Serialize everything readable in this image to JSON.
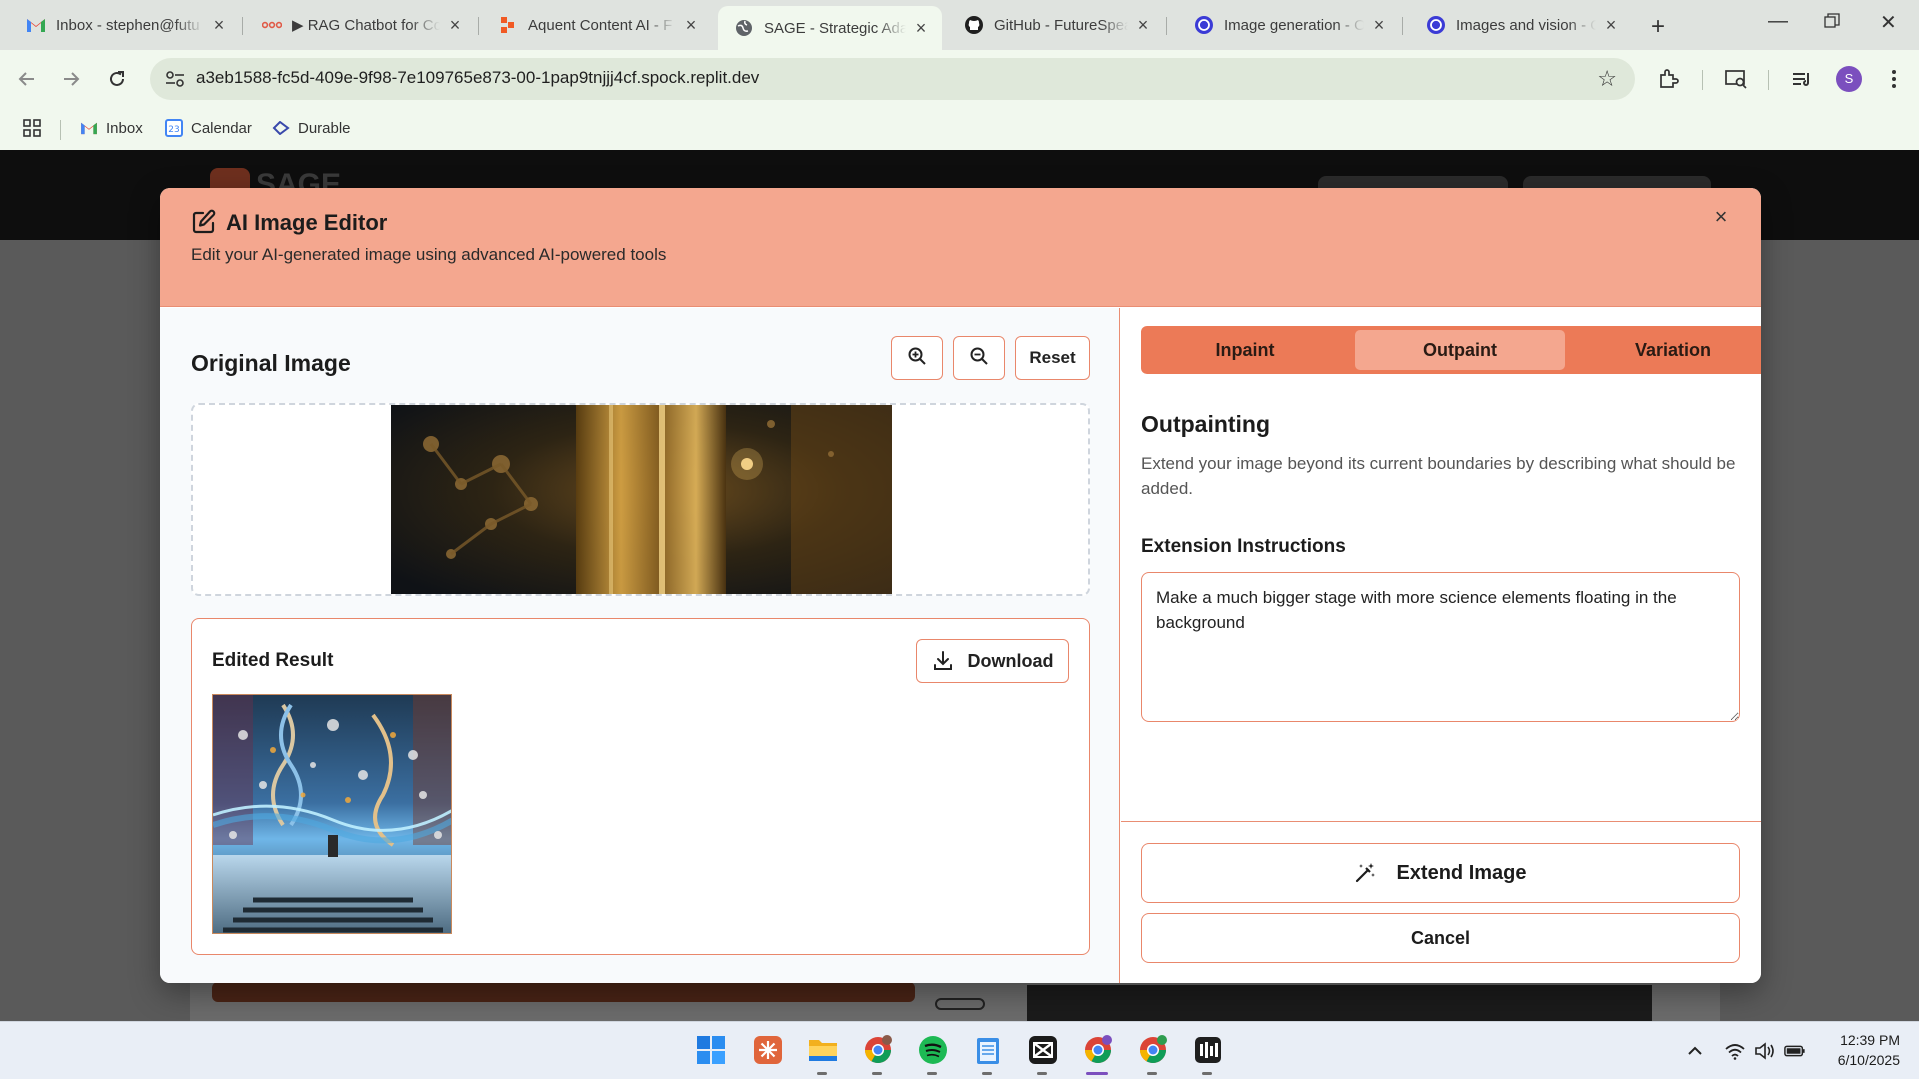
{
  "browser": {
    "tabs": [
      {
        "title": "Inbox - stephen@futu",
        "icon": "gmail-icon",
        "active": false
      },
      {
        "title": "▶ RAG Chatbot for Co",
        "icon": "rag-icon",
        "active": false
      },
      {
        "title": "Aquent Content AI - F",
        "icon": "aquent-icon",
        "active": false
      },
      {
        "title": "SAGE - Strategic Adap",
        "icon": "globe-icon",
        "active": true
      },
      {
        "title": "GitHub - FutureSpeak",
        "icon": "github-icon",
        "active": false
      },
      {
        "title": "Image generation - O",
        "icon": "openai-icon",
        "active": false
      },
      {
        "title": "Images and vision - O",
        "icon": "openai-icon",
        "active": false
      }
    ],
    "url": "a3eb1588-fc5d-409e-9f98-7e109765e873-00-1pap9tnjjj4cf.spock.replit.dev",
    "profile_initial": "S",
    "bookmarks": [
      {
        "label": "Inbox",
        "icon": "gmail-icon"
      },
      {
        "label": "Calendar",
        "icon": "calendar-icon"
      },
      {
        "label": "Durable",
        "icon": "durable-icon"
      }
    ]
  },
  "page_behind": {
    "logo_text": "SAGE"
  },
  "modal": {
    "title": "AI Image Editor",
    "subtitle": "Edit your AI-generated image using advanced AI-powered tools",
    "close_label": "×",
    "original": {
      "heading": "Original Image",
      "zoom_in": "zoom-in-icon",
      "zoom_out": "zoom-out-icon",
      "reset_label": "Reset"
    },
    "result": {
      "heading": "Edited Result",
      "download_label": "Download"
    },
    "tabs": [
      {
        "label": "Inpaint",
        "active": false
      },
      {
        "label": "Outpaint",
        "active": true
      },
      {
        "label": "Variation",
        "active": false
      }
    ],
    "panel": {
      "heading": "Outpainting",
      "description": "Extend your image beyond its current boundaries by describing what should be added.",
      "field_label": "Extension Instructions",
      "field_value": "Make a much bigger stage with more science elements floating in the background",
      "extend_label": "Extend Image",
      "cancel_label": "Cancel"
    },
    "colors": {
      "header": "#f4a78f",
      "tabs_bg": "#ec7a57",
      "border": "#e9876b"
    }
  },
  "taskbar": {
    "apps": [
      "windows-start-icon",
      "claude-icon",
      "file-explorer-icon",
      "chrome-icon",
      "spotify-icon",
      "notepad-icon",
      "capcut-icon",
      "chrome-profile-icon",
      "chrome-profile-2-icon",
      "audio-app-icon"
    ],
    "time": "12:39 PM",
    "date": "6/10/2025"
  }
}
